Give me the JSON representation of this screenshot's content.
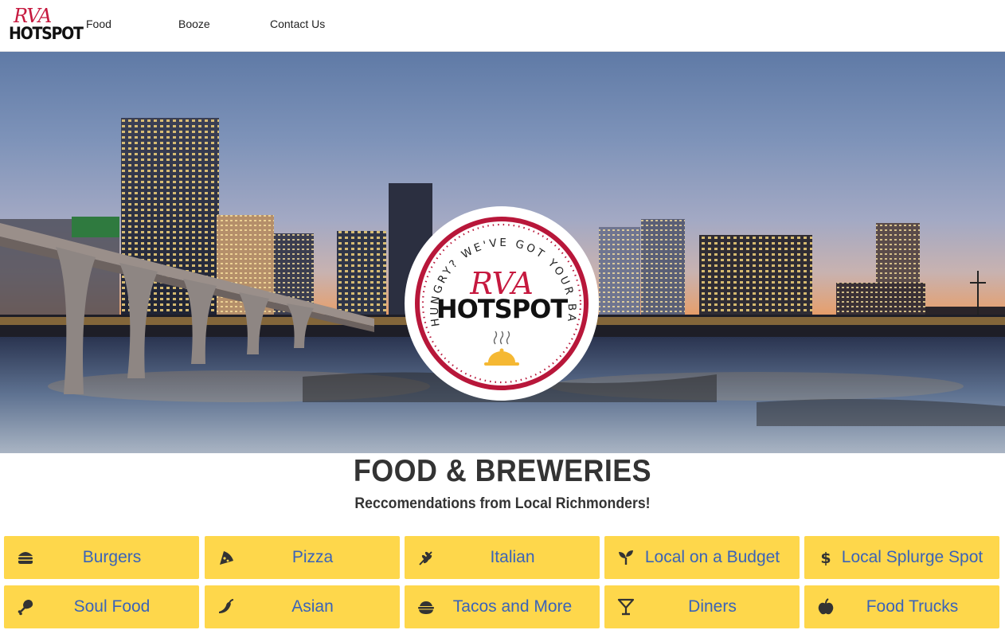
{
  "nav": {
    "brand_script": "RVA",
    "brand_bold": "HOTSPOT",
    "links": [
      "Food",
      "Booze",
      "Contact Us"
    ]
  },
  "badge": {
    "script": "RVA",
    "bold": "HOTSPOT",
    "ring_text": "HUNGRY? WE'VE GOT YOUR BACK!"
  },
  "main": {
    "title": "FOOD & BREWERIES",
    "subtitle": "Reccomendations from Local Richmonders!"
  },
  "categories": [
    {
      "label": "Burgers",
      "icon": "hamburger-icon"
    },
    {
      "label": "Pizza",
      "icon": "pizza-slice-icon"
    },
    {
      "label": "Italian",
      "icon": "wheat-icon"
    },
    {
      "label": "Local on a Budget",
      "icon": "seedling-icon"
    },
    {
      "label": "Local Splurge Spot",
      "icon": "dollar-sign-icon"
    },
    {
      "label": "Soul Food",
      "icon": "drumstick-icon"
    },
    {
      "label": "Asian",
      "icon": "pepper-icon"
    },
    {
      "label": "Tacos and More",
      "icon": "bowl-icon"
    },
    {
      "label": "Diners",
      "icon": "cocktail-icon"
    },
    {
      "label": "Food Trucks",
      "icon": "apple-icon"
    }
  ],
  "colors": {
    "button_bg": "#fed74b",
    "button_text": "#3a63b8",
    "brand_red": "#c6193f",
    "heading": "#333333"
  }
}
